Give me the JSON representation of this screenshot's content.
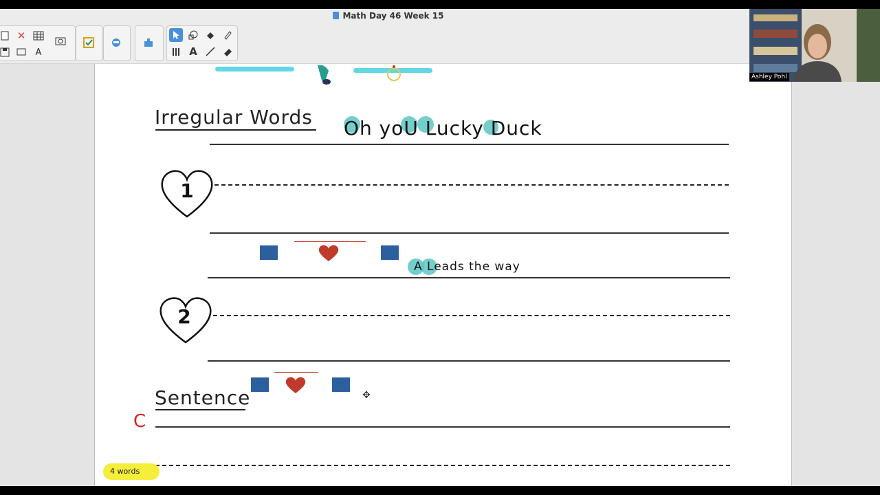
{
  "window": {
    "title": "Math Day 46 Week 15"
  },
  "toolbar": {
    "file_tools": [
      "new-page-icon",
      "delete-icon",
      "table-icon",
      "save-icon",
      "screen-icon",
      "text-recognition-icon"
    ],
    "display_tools": [
      "screen-shade-icon",
      "checkbox-icon",
      "spy-icon"
    ],
    "add_ons": [
      "addon-icon"
    ],
    "draw_tools": [
      "select-arrow-icon",
      "shape-icon",
      "fill-icon",
      "pen-icon",
      "magic-pen-icon",
      "text-icon",
      "line-icon",
      "eraser-icon"
    ]
  },
  "worksheet": {
    "heading_irregular": "Irregular Words",
    "lucky_phrase": "Oh yoU Lucky Duck",
    "heart1_number": "1",
    "heart2_number": "2",
    "leads_phrase": "A Leads the way",
    "heading_sentence": "Sentence",
    "sentence_prefix": "C",
    "word_count_label": "4 words"
  },
  "video": {
    "participant_name": "Ashley Pohl"
  },
  "colors": {
    "accent_blue": "#2c5f9e",
    "heart_red": "#c0392b",
    "highlight_teal": "#5cc6c3",
    "highlight_yellow": "#f5ee3a"
  }
}
